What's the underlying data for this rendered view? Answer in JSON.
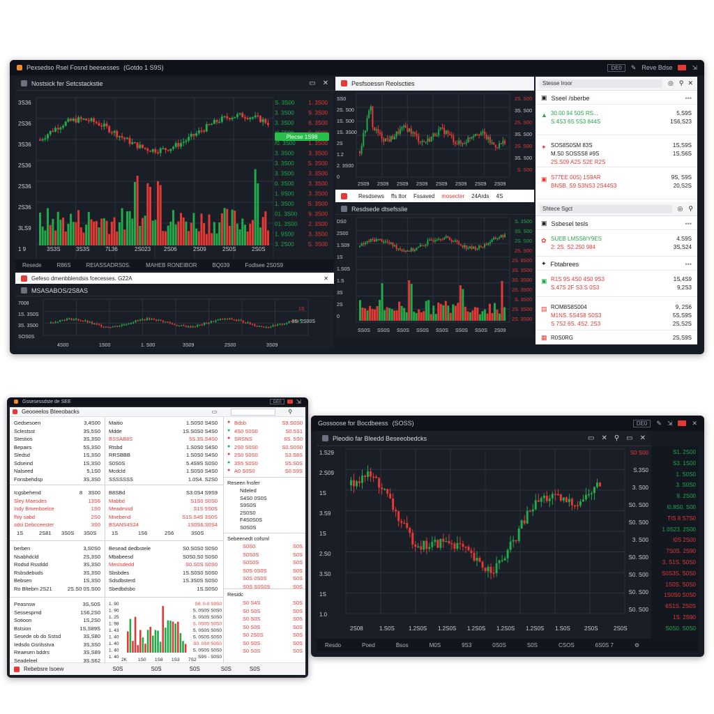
{
  "colors": {
    "up": "#22a94a",
    "down": "#e53935",
    "bg": "#1a1e27",
    "grid": "#2c3240",
    "accent": "#f28c28"
  },
  "win1": {
    "title": "Pexsedso Rsel Fosnd beesesses",
    "title_extra": "(Gotdo 1 S9S)",
    "tb_box": "DE0",
    "tb_label": "Reve Bdse",
    "chart1": {
      "header": "Nostsick fer Setcstackstie",
      "y_labels": [
        "3S36",
        "2S36",
        "3S36",
        "2S36",
        "2S36",
        "2S36",
        "3LS9",
        "1 9"
      ],
      "x_labels": [
        "3S3S",
        "3S3S",
        "7L36",
        "2S023",
        "2S06",
        "2S09",
        "2S0S",
        "2S0S"
      ],
      "side_prices": [
        {
          "a": "S. 3S00",
          "b": "1. 3S00",
          "ca": "green",
          "cb": "red"
        },
        {
          "a": "3. 3S00",
          "b": "9. 3S00",
          "ca": "green",
          "cb": "red"
        },
        {
          "a": "3. 3S00",
          "b": "6. 3S00",
          "ca": "green",
          "cb": "red"
        },
        {
          "a": "/0 7S00",
          "b": "S. 3S00",
          "ca": "green",
          "cb": "red"
        },
        {
          "a": "/0. 3S00",
          "b": "1. 3S00",
          "ca": "green",
          "cb": "red"
        },
        {
          "a": "3. 3S00",
          "b": "3. 3S00",
          "ca": "green",
          "cb": "red"
        },
        {
          "a": "3. 3S00",
          "b": "S. 3S00",
          "ca": "green",
          "cb": "red"
        },
        {
          "a": "3. 3S00",
          "b": "3. 3S00",
          "ca": "green",
          "cb": "red"
        },
        {
          "a": "0. 3S00",
          "b": "3. 3S00",
          "ca": "green",
          "cb": "red"
        },
        {
          "a": "1. 9S00",
          "b": "3. 3S00",
          "ca": "green",
          "cb": "red"
        },
        {
          "a": "1. 3S00",
          "b": "S. 3S00",
          "ca": "green",
          "cb": "red"
        },
        {
          "a": "01. 3S00",
          "b": "9. 3S00",
          "ca": "green",
          "cb": "red"
        },
        {
          "a": "01. 3S00",
          "b": "2. 3S00",
          "ca": "green",
          "cb": "red"
        },
        {
          "a": "1. 9S00",
          "b": "3. 3S00",
          "ca": "green",
          "cb": "red"
        },
        {
          "a": "3. 2S00",
          "b": "S. 3S00",
          "ca": "green",
          "cb": "red"
        }
      ],
      "buy_button": "Plecse 1S98",
      "footer": [
        "Resede",
        "R86S",
        "REIASSADRS0S.",
        "MAHEB RONEIBOR",
        "BQ039",
        "Fodlsee 2S0S9"
      ]
    },
    "notice_bar": "Gefeso dmenbblendsis fcecesses. G22A",
    "chart2": {
      "header": "MSASABOS/2S8AS",
      "y_labels": [
        "7008",
        "1S. 3S0S",
        "3S. 3S00",
        "SOS0S"
      ],
      "x_labels": [
        "4S00",
        "1S00",
        "1. S00",
        "3S09",
        "2S00",
        "3S09"
      ],
      "right_label": "0S. 2S00S",
      "right_label2": "1S"
    },
    "mid_top": {
      "header": "Pesfsoessn Reolscties",
      "y_labels": [
        "SS0",
        "2S. S00",
        "1S. S00",
        "1S. 3S00",
        "2S",
        "1.2",
        "2. 3S00",
        "0"
      ],
      "x_labels": [
        "2S09",
        "2S09",
        "2S09",
        "2S09",
        "2S09",
        "2S09",
        "2S09",
        "2S09"
      ],
      "right_labels": [
        "2S. S00",
        "3S. S00",
        "2S. S00",
        "3S. S00",
        "2S. S00",
        "3S. S00",
        "S. S00"
      ]
    },
    "mid_tabs": [
      "Resdsews",
      "ffs ttor",
      "Fssaved",
      "mosecter",
      "24Ards",
      "4S"
    ],
    "mid_bot": {
      "header": "Resdsede dtsefsslie",
      "y_labels": [
        "DS0",
        "2S00",
        "1.S09",
        "1S",
        "1.S0S",
        "1.S",
        "3S",
        "2S",
        "0"
      ],
      "x_labels": [
        "SS0S",
        "SS0S",
        "SS0S",
        "SS0S",
        "SS0S",
        "SS0S",
        "SS0S",
        "2S09"
      ],
      "right_labels": [
        "S. 3S00",
        "3S. S00",
        "2S. S00",
        "2S. S00",
        "2S. 8S00",
        "3S. 3S00",
        "3S. 3S00",
        "2S. 3S00",
        "S. 3S00",
        "2S. 3S00",
        "2S. 3S00"
      ]
    },
    "watch": {
      "search1": "Stesse lroor",
      "group1": "Sseel /sberbe",
      "rows1": [
        {
          "icon": "▲",
          "a": "30.00 94 50S RS...",
          "b": "S.4S3 6S 5S3 844S",
          "v1": "5,S9S",
          "v2": "1S6,S23",
          "ca": "green",
          "cb": "green"
        },
        {
          "icon": "✦",
          "a": "SOS8S0SM 83S",
          "b": "M.S0 SOSSS8 #9S",
          "b2": "2S.S09 A2S S2E R2S",
          "v1": "1S,S9S",
          "v2": "1S,S6S",
          "ca": "dark",
          "cb": "dark"
        },
        {
          "icon": "▣",
          "a": "S77EE 00S) 1S9AR",
          "b": "BNSB. S9 S3NS3 2S44S3",
          "v1": "9S, S9S",
          "v2": "20,S2S",
          "ca": "red",
          "cb": "red"
        }
      ],
      "search2": "Shtece Sgct",
      "group2": "Ssbesel tesls",
      "rows2": [
        {
          "icon": "✿",
          "a": "SUEB LMSS8/Y9ES",
          "b": "2: 2S. S2.250 984",
          "v1": "4.S9S",
          "v2": "3S,S24"
        }
      ],
      "group3": "Fbtabrees",
      "rows3": [
        {
          "icon": "▣",
          "a": "R1S 9S 4S0 4S0 9S3",
          "b": "S.47S 2F S3.S 0S3",
          "v1": "1S,4S9",
          "v2": "9,2S3"
        },
        {
          "icon": "▤",
          "a": "ROM8S8S004",
          "b": "M1NS. 5S4S8 S0S3",
          "b2": "S 7S2 6S. 4S2. 2S3",
          "v1": "9, 2S6",
          "v2": "5S,S9S",
          "v3": "2S,S2S"
        },
        {
          "icon": "▦",
          "a": "R0S0RG",
          "b": "",
          "v1": "2S,S9S",
          "v2": ""
        }
      ]
    }
  },
  "win2": {
    "header": "Geooeelos Bteeobacks",
    "search": "",
    "col1": {
      "rows": [
        [
          "Gedsesoen",
          "3,4S00"
        ],
        [
          "Sclestsst",
          "3S,5S0"
        ],
        [
          "Stestios",
          "3S,3S0"
        ],
        [
          "Bepairs",
          "5S,3S0"
        ],
        [
          "Sledsd",
          "1S,3S0"
        ],
        [
          "Sdseind",
          "1S,3S0"
        ],
        [
          "Nalseed",
          "5,1S0"
        ],
        [
          "Fonsbehdsp",
          "3S,3S0"
        ]
      ],
      "rows2": [
        {
          "a": "Icgsbehend",
          "b": "8",
          "c": "3S00",
          "ca": "dark"
        },
        {
          "a": "Sley Maesdes",
          "b": "",
          "c": "13S6",
          "ca": "red"
        },
        {
          "a": "Indy Bmenbselce",
          "b": "",
          "c": "1S0",
          "ca": "red"
        },
        {
          "a": "fhiy sabd",
          "b": "",
          "c": "2S0",
          "ca": "red"
        },
        {
          "a": "sdsi Debcceester",
          "b": "",
          "c": "3S0",
          "ca": "red"
        }
      ],
      "xrow": [
        "1S",
        "2S81",
        "3S0S",
        "3S0S"
      ],
      "rows3": [
        [
          "berben",
          "3,S0S0"
        ],
        [
          "Nsabhdcld",
          "2S,3S0"
        ],
        [
          "Rodsd Rsstldd",
          "3S,3S0"
        ],
        [
          "Rsbsdebuds",
          "3S,3S0"
        ],
        [
          "Bebsen",
          "1S,3S0"
        ],
        [
          "Ro Bltebm 2S21",
          "2S.S0  0S.S00"
        ]
      ],
      "rows4": [
        [
          "Peasnsw",
          "3S,S0S"
        ],
        [
          "Sessesprnd",
          "1S6,2S0"
        ],
        [
          "Sotioon",
          "1S,2S0"
        ],
        [
          "Bstsion",
          "1S,S89S"
        ],
        [
          "Sesede ob do Sstsd",
          "3S,S80"
        ],
        [
          "Iedsdo Gsrilsstva",
          "3S,3S0"
        ],
        [
          "Reaesen bddrs",
          "3S,S89"
        ],
        [
          "Seadeleel",
          "3S,S62"
        ]
      ]
    },
    "col2": {
      "rows": [
        [
          "Maitio",
          "1.S0S0 S4S0",
          "dark"
        ],
        [
          "Mdde",
          "1S.S0S0 S4S0",
          "dark"
        ],
        [
          "BSSAB8S",
          "5S.3S.S4S0",
          "red"
        ],
        [
          "Rtsbd",
          "1.S0S0 S4S0",
          "dark"
        ],
        [
          "RRSBBB",
          "1.S0S0 S4S0",
          "dark"
        ],
        [
          "S0S0S",
          "5.4S9S S0S0",
          "dark"
        ],
        [
          "Mcdcld",
          "1.S0S0 S4S0",
          "dark"
        ],
        [
          "SSSSSSS",
          "1.0S4. S2S0",
          "dark"
        ]
      ],
      "rows2": [
        [
          "B8SBd",
          "S3.0S4 S9S9",
          "dark"
        ],
        [
          "Mabbd",
          "S1S0 S0S0",
          "red"
        ],
        [
          "Meadmisd",
          "S1S 5S0S",
          "red"
        ],
        [
          "Mnebend",
          "S1S.S4S 3S0S",
          "red"
        ],
        [
          "BSANS4S24",
          "1S0S6.S0S4",
          "red"
        ]
      ],
      "xrow": [
        "1S",
        "1S6",
        "2S6",
        "3S0S"
      ],
      "rows3": [
        [
          "Besead dedbstele",
          "S0.S0S0 S0S0",
          "dark"
        ],
        [
          "Mbabeesd",
          "S0S0.S0 S0S0",
          "dark"
        ],
        [
          "Meslsdedd",
          "S0.S0S S0S0",
          "red"
        ],
        [
          "Sbsbdes",
          "1S.S0S0 S0S0",
          "dark"
        ],
        [
          "Sdsdbsterd",
          "1S.3S0S S0S0",
          "dark"
        ],
        [
          "Sbedbdsbo",
          "1S.S0S0",
          "dark"
        ]
      ],
      "y_labels": [
        "1. 90",
        "1. 90",
        "1. 25",
        "1. 98",
        "1. 43",
        "1. 40",
        "1. 40",
        "1. 40",
        "1. 40"
      ],
      "y_right": [
        "S0. 0-0 S9S0",
        "S. 0S0S S0S0",
        "S. 0S0S S0S0",
        "S. 0S0S S0S0",
        "S. 0S0S S0S0",
        "S. 0S0S S0S0",
        "S0. 0S0 S0S0",
        "S. 0S0S S0S0",
        "S9S - S0S0"
      ],
      "x_labels": [
        "2K",
        "1S0",
        "1S8",
        "1S3",
        "7S2"
      ]
    },
    "col3": {
      "rows": [
        [
          "Bdsb",
          "S9.S0S0",
          "red"
        ],
        [
          "4S0 S0S0",
          "S0.5S1",
          "red"
        ],
        [
          "SRSNS",
          "6S. 5S0",
          "red"
        ],
        [
          "2S0 S0S0",
          "S0.S0S0",
          "red"
        ],
        [
          "2S0 S0S0",
          "S3.S8S",
          "red"
        ],
        [
          "3S5 S0S0",
          "S5.S0S",
          "red"
        ],
        [
          "A0 S0S0",
          "S0.S9S",
          "red"
        ]
      ],
      "panel2_header": "Reseen fnsfer",
      "panel2_items": [
        "Ndeled",
        "S4S0 0S0S",
        "S9S0S",
        "2S0S0",
        "F4S0S0S",
        "S0S0S"
      ],
      "panel3_header": "Sebeenedt cofsml",
      "panel3_items": [
        [
          "S0S0",
          "S0S"
        ],
        [
          "S0S0S",
          "S0S"
        ],
        [
          "S0S0S",
          "S0S"
        ],
        [
          "S0S 0S0S",
          "S0S"
        ],
        [
          "S0S 0S0S",
          "S0S"
        ],
        [
          "S0S S0S0S",
          "S0S"
        ]
      ],
      "panel4_header": "Residc",
      "panel4_items": [
        [
          "S0 S4S",
          "S0S"
        ],
        [
          "S0 S0S",
          "S0S"
        ],
        [
          "S0 S0S",
          "S0S"
        ],
        [
          "S0 S0S",
          "S0S"
        ],
        [
          "S0 2S0S",
          "S0S"
        ],
        [
          "S0 S0S",
          "S0S"
        ],
        [
          "S0 S0S",
          "S0S"
        ]
      ]
    },
    "footer": "Rebebsre lsoew",
    "footer_x": [
      "S0S",
      "S0S",
      "S0S",
      "S0S",
      "S0S"
    ]
  },
  "win3": {
    "title": "Gossoose for Bocdbeess",
    "title_extra": "(SOSS)",
    "tb_box": "DE0",
    "header": "Pleodio far Bleedd Beseeobedcks",
    "y_labels": [
      "1.S29",
      "2.S09",
      "1S",
      "3.S9",
      "1S",
      "2.S0",
      "3.S0",
      "1S",
      "1.0"
    ],
    "x_labels": [
      "2S08",
      "1.S0S",
      "1.2S0S",
      "1.2S0S",
      "1.2S0S",
      "1.2S0S",
      "1.2S0S",
      "1.S0S",
      "2S0S",
      "2S0S"
    ],
    "right_axis": [
      "S0 S00",
      "S.3S0",
      "3. S00",
      "S0. S00",
      "S0. S00",
      "3. S00",
      "S0. S00",
      "S0. S00",
      "S0. S00",
      "S0. S00"
    ],
    "prices": [
      {
        "v": "S1. 2S00",
        "c": "green"
      },
      {
        "v": "S3. 1S00",
        "c": "green"
      },
      {
        "v": "1. S0S0",
        "c": "green"
      },
      {
        "v": "3. S0S0",
        "c": "green"
      },
      {
        "v": "9. 2S00",
        "c": "green"
      },
      {
        "v": "I0,8S0. S00",
        "c": "green"
      },
      {
        "v": "TIS 8 S7S0",
        "c": "red"
      },
      {
        "v": "1.0S23. 2S00",
        "c": "green"
      },
      {
        "v": "I0S 2S00",
        "c": "red"
      },
      {
        "v": "7S0S. 2S90",
        "c": "red"
      },
      {
        "v": "3, S1S. S0S0",
        "c": "red"
      },
      {
        "v": "S0S3S. S0S0",
        "c": "red"
      },
      {
        "v": "1S0S. S0S0",
        "c": "red"
      },
      {
        "v": "1S0S0 S0S0",
        "c": "red"
      },
      {
        "v": "6S1S. 2S0S",
        "c": "red"
      },
      {
        "v": "1S. 2S90",
        "c": "red"
      },
      {
        "v": "S0S0. S0S0",
        "c": "green"
      }
    ],
    "footer": [
      "Resdo",
      "Poed",
      "Bsos",
      "M0S",
      "9S3",
      "0S0S",
      "S0S",
      "CSOS",
      "6S0S 7"
    ]
  }
}
